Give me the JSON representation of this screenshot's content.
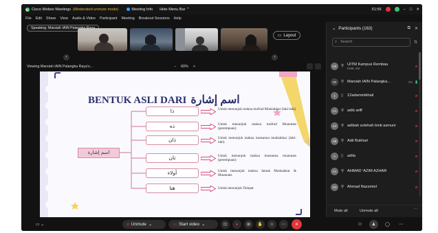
{
  "window": {
    "app_name": "Cisco Webex Meetings",
    "mode": "(Moderated unmute mode)",
    "meeting_info": "Meeting Info",
    "hide_menu": "Hide Menu Bar",
    "time": "51:56"
  },
  "menu": [
    "File",
    "Edit",
    "Share",
    "View",
    "Audio & Video",
    "Participant",
    "Meeting",
    "Breakout Sessions",
    "Help"
  ],
  "speaking": "Speaking: Marsiah IAIN Palangka Raya",
  "layout_label": "Layout",
  "viewing": {
    "label": "Viewing Marsiah IAIN Palangka Raya's...",
    "zoom_minus": "−",
    "zoom": "60%",
    "zoom_plus": "+"
  },
  "slide": {
    "title_latin": "BENTUK ASLI DARI",
    "title_arabic": "اسم إشارة",
    "root": "اسم إشارة",
    "rows": [
      {
        "ar": "ذا",
        "desc": "Untuk menunjuk makna mufrad Mudzakkar (laki-laki)"
      },
      {
        "ar": "ذه",
        "desc": "Untuk menunjuk makna mufrad Muannats (perempuan)"
      },
      {
        "ar": "ذان",
        "desc": "Untuk menunjuk makna mutsanna mudzakkar (laki-laki)"
      },
      {
        "ar": "تان",
        "desc": "Untuk menunjuk makna mutsanna muannats (perempuan)"
      },
      {
        "ar": "أولاء",
        "desc": "Untuk menunjuk makna Jamak Mudzakkar & Muannats"
      },
      {
        "ar": "هنا",
        "desc": "Untuk menunjuk Tempat"
      }
    ]
  },
  "toolbar": {
    "unmute": "Unmute",
    "start_video": "Start video"
  },
  "participants": {
    "title": "Participants (163)",
    "search_placeholder": "Search",
    "list": [
      {
        "initials": "UK",
        "name": "UITM Kampus Rembau",
        "sub": "Host, me",
        "muted": true
      },
      {
        "initials": "MI",
        "name": "Marsiah IAIN Palangka...",
        "sub": "",
        "muted": false
      },
      {
        "initials": "1",
        "name": "12adammikhail",
        "sub": "",
        "muted": true
      },
      {
        "initials": "AA",
        "name": "adib ariff",
        "sub": "",
        "muted": true
      },
      {
        "initials": "AA",
        "name": "adibah solehah binti asmuni",
        "sub": "",
        "muted": true
      },
      {
        "initials": "AB",
        "name": "Adil Bukhari",
        "sub": "",
        "muted": true
      },
      {
        "initials": "A",
        "name": "adila",
        "sub": "",
        "muted": true
      },
      {
        "initials": "AA",
        "name": "AHMAD 'AZIM AZHAR",
        "sub": "",
        "muted": true
      },
      {
        "initials": "AN",
        "name": "Ahmad Nazzmiel",
        "sub": "",
        "muted": true
      }
    ],
    "mute_all": "Mute all",
    "unmute_all": "Unmute all"
  },
  "colors": {
    "accent_red": "#e2363c",
    "slide_title": "#2b2e6e",
    "box_border": "#d98aa0",
    "root_fill": "#f3c9d8"
  }
}
